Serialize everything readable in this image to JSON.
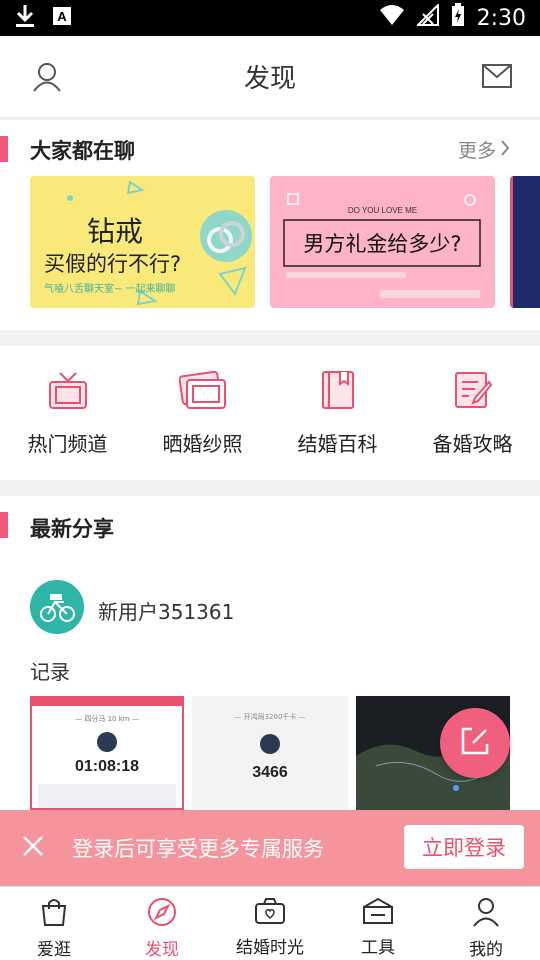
{
  "status_bar": {
    "time": "2:30"
  },
  "header": {
    "title": "发现"
  },
  "chat_section": {
    "title": "大家都在聊",
    "more_label": "更多",
    "banners": [
      {
        "line1": "钻戒",
        "line2": "买假的行不行?",
        "tagline": "气嗑八舌聊天室~  一起来聊聊",
        "bg": "#f9e97a"
      },
      {
        "small_caps": "DO YOU LOVE ME",
        "main": "男方礼金给多少?",
        "bg": "#ffb3c6"
      }
    ]
  },
  "categories": [
    {
      "label": "热门频道",
      "icon": "tv-icon"
    },
    {
      "label": "晒婚纱照",
      "icon": "photo-icon"
    },
    {
      "label": "结婚百科",
      "icon": "book-icon"
    },
    {
      "label": "备婚攻略",
      "icon": "notepad-icon"
    }
  ],
  "latest_section": {
    "title": "最新分享",
    "post": {
      "username": "新用户351361",
      "text": "记录",
      "thumbs": [
        {
          "time": "01:08:18",
          "caption": "— 四分马 10 km —"
        },
        {
          "value": "3466",
          "caption": "— 开鸿局3200千卡 —"
        },
        {
          "kind": "map"
        }
      ]
    }
  },
  "login_bar": {
    "message": "登录后可享受更多专属服务",
    "button": "立即登录"
  },
  "tabs": [
    {
      "label": "爱逛",
      "icon": "shopping-bag-icon"
    },
    {
      "label": "发现",
      "icon": "compass-icon",
      "active": true
    },
    {
      "label": "结婚时光",
      "icon": "camera-icon"
    },
    {
      "label": "工具",
      "icon": "toolbox-icon"
    },
    {
      "label": "我的",
      "icon": "user-icon"
    }
  ],
  "colors": {
    "accent": "#e8506e",
    "login_bar": "#f58c96"
  }
}
